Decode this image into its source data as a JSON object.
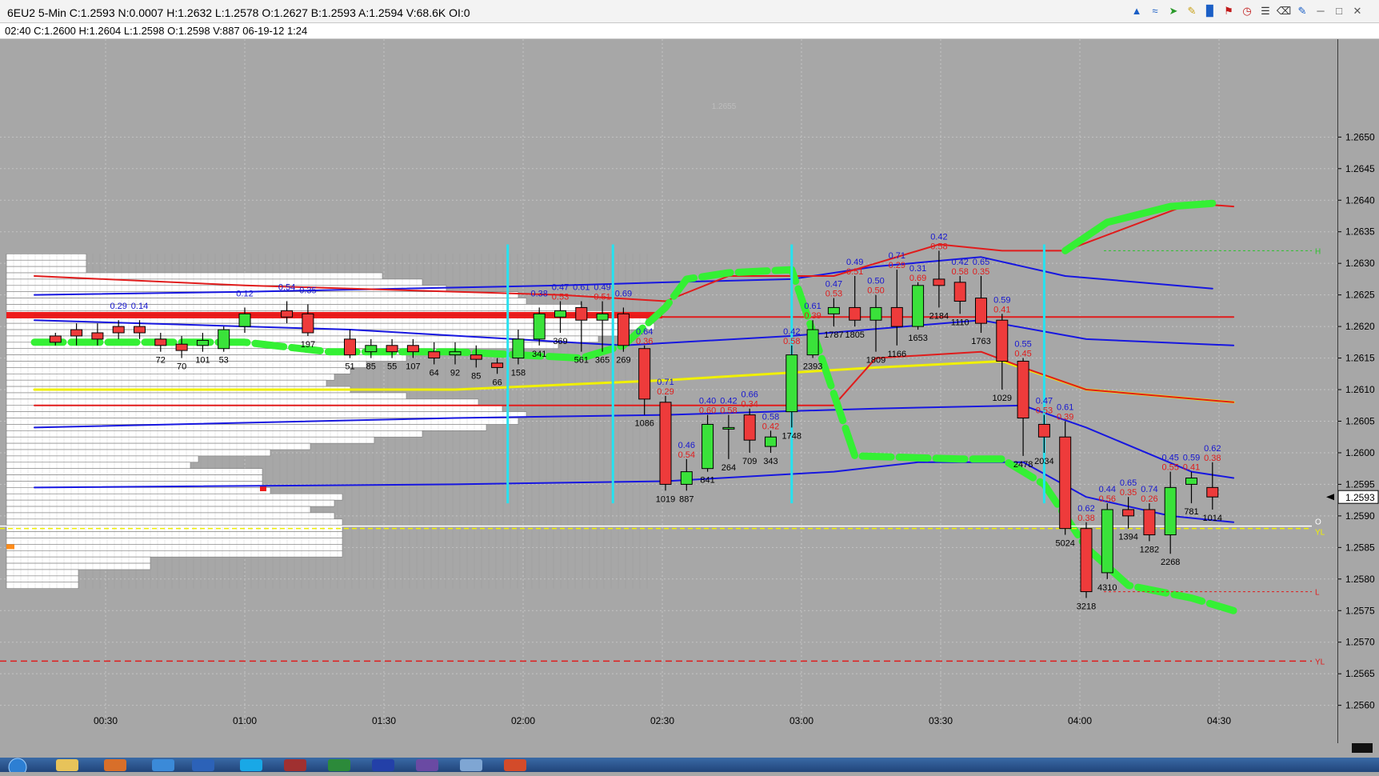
{
  "window": {
    "title": "6EU2  5-Min   C:1.2593   N:0.0007   H:1.2632   L:1.2578   O:1.2627   B:1.2593   A:1.2594   V:68.6K   OI:0",
    "info": "02:40  C:1.2600  H:1.2604  L:1.2598  O:1.2598  V:887  06-19-12  1:24",
    "toolbar_icons": [
      "cursor-icon",
      "draw-icon",
      "arrow-tool-icon",
      "pencil-icon",
      "bar-chart-icon",
      "flag-icon",
      "clock-icon",
      "list-icon",
      "trash-icon",
      "ruler-icon",
      "minimize-icon",
      "restore-icon",
      "close-icon"
    ]
  },
  "chart": {
    "watermark_price": "1.2655",
    "last_price_label": "1.2593",
    "yl_label": "YL",
    "h_label": "H",
    "l_label": "L",
    "o_label": "O",
    "colors": {
      "up": "#3ae23a",
      "down": "#ee3b3b",
      "blue": "#1717e0",
      "red": "#e01c1c",
      "yellow": "#f0f000",
      "green": "#34f034",
      "cyan": "#25e2f0",
      "bg": "#a7a7a7"
    }
  },
  "chart_data": {
    "type": "candlestick",
    "title": "6EU2 5-Min",
    "y_ticks": [
      "1.2650",
      "1.2645",
      "1.2640",
      "1.2635",
      "1.2630",
      "1.2625",
      "1.2620",
      "1.2615",
      "1.2610",
      "1.2605",
      "1.2600",
      "1.2595",
      "1.2590",
      "1.2585",
      "1.2580",
      "1.2575",
      "1.2570",
      "1.2565",
      "1.2560"
    ],
    "x_ticks": [
      "00:30",
      "01:00",
      "01:30",
      "02:00",
      "02:30",
      "03:00",
      "03:30",
      "04:00",
      "04:30"
    ],
    "candles": [
      {
        "x": 1,
        "o": 1.26185,
        "c": 1.26175,
        "h": 1.2619,
        "l": 1.2617,
        "a": "",
        "r": "",
        "b": ""
      },
      {
        "x": 2,
        "o": 1.26195,
        "c": 1.26185,
        "h": 1.26205,
        "l": 1.2617,
        "a": "",
        "r": "",
        "b": ""
      },
      {
        "x": 3,
        "o": 1.2619,
        "c": 1.2618,
        "h": 1.26205,
        "l": 1.2617,
        "a": "",
        "r": "",
        "b": ""
      },
      {
        "x": 4,
        "o": 1.262,
        "c": 1.2619,
        "h": 1.2621,
        "l": 1.2618,
        "a": "0.29",
        "r": "",
        "b": ""
      },
      {
        "x": 5,
        "o": 1.262,
        "c": 1.2619,
        "h": 1.2621,
        "l": 1.2618,
        "a": "0.14",
        "r": "",
        "b": ""
      },
      {
        "x": 6,
        "o": 1.2618,
        "c": 1.2617,
        "h": 1.2619,
        "l": 1.2616,
        "a": "",
        "r": "",
        "b": "72"
      },
      {
        "x": 7,
        "o": 1.26172,
        "c": 1.26162,
        "h": 1.26185,
        "l": 1.2615,
        "a": "",
        "r": "",
        "b": "70"
      },
      {
        "x": 8,
        "o": 1.2617,
        "c": 1.26178,
        "h": 1.2619,
        "l": 1.2616,
        "a": "",
        "r": "",
        "b": "101"
      },
      {
        "x": 9,
        "o": 1.26165,
        "c": 1.26195,
        "h": 1.262,
        "l": 1.2616,
        "a": "",
        "r": "",
        "b": "53"
      },
      {
        "x": 10,
        "o": 1.262,
        "c": 1.2622,
        "h": 1.2623,
        "l": 1.2619,
        "a": "0.12",
        "r": "",
        "b": ""
      },
      {
        "x": 12,
        "o": 1.26225,
        "c": 1.26215,
        "h": 1.2624,
        "l": 1.26205,
        "a": "0.54",
        "r": "",
        "b": ""
      },
      {
        "x": 13,
        "o": 1.2622,
        "c": 1.2619,
        "h": 1.26235,
        "l": 1.26185,
        "a": "0.35",
        "r": "",
        "b": "197"
      },
      {
        "x": 15,
        "o": 1.2618,
        "c": 1.26155,
        "h": 1.26195,
        "l": 1.2615,
        "a": "",
        "r": "",
        "b": "51"
      },
      {
        "x": 16,
        "o": 1.2616,
        "c": 1.2617,
        "h": 1.2618,
        "l": 1.2615,
        "a": "",
        "r": "",
        "b": "85"
      },
      {
        "x": 17,
        "o": 1.2617,
        "c": 1.2616,
        "h": 1.2618,
        "l": 1.2615,
        "a": "",
        "r": "",
        "b": "55"
      },
      {
        "x": 18,
        "o": 1.2617,
        "c": 1.2616,
        "h": 1.2618,
        "l": 1.2615,
        "a": "",
        "r": "",
        "b": "107"
      },
      {
        "x": 19,
        "o": 1.2616,
        "c": 1.2615,
        "h": 1.26175,
        "l": 1.2614,
        "a": "",
        "r": "",
        "b": "64"
      },
      {
        "x": 20,
        "o": 1.26155,
        "c": 1.2616,
        "h": 1.26175,
        "l": 1.2614,
        "a": "",
        "r": "",
        "b": "92"
      },
      {
        "x": 21,
        "o": 1.26155,
        "c": 1.26148,
        "h": 1.2617,
        "l": 1.26135,
        "a": "",
        "r": "",
        "b": "85"
      },
      {
        "x": 22,
        "o": 1.26142,
        "c": 1.26135,
        "h": 1.2615,
        "l": 1.26125,
        "a": "",
        "r": "",
        "b": "66"
      },
      {
        "x": 23,
        "o": 1.2615,
        "c": 1.2618,
        "h": 1.26195,
        "l": 1.2614,
        "a": "",
        "r": "",
        "b": "158"
      },
      {
        "x": 24,
        "o": 1.2618,
        "c": 1.2622,
        "h": 1.2623,
        "l": 1.2617,
        "a": "0.38",
        "r": "",
        "b": "341"
      },
      {
        "x": 25,
        "o": 1.26215,
        "c": 1.26225,
        "h": 1.2624,
        "l": 1.2619,
        "a": "0.47",
        "r": "0.53",
        "b": "369"
      },
      {
        "x": 26,
        "o": 1.2623,
        "c": 1.2621,
        "h": 1.2624,
        "l": 1.2616,
        "a": "0.61",
        "r": "",
        "b": "561"
      },
      {
        "x": 27,
        "o": 1.2621,
        "c": 1.2622,
        "h": 1.2624,
        "l": 1.2616,
        "a": "0.49",
        "r": "0.51",
        "b": "365"
      },
      {
        "x": 28,
        "o": 1.2622,
        "c": 1.2617,
        "h": 1.2623,
        "l": 1.2616,
        "a": "0.69",
        "r": "",
        "b": "269"
      },
      {
        "x": 29,
        "o": 1.26165,
        "c": 1.26085,
        "h": 1.2617,
        "l": 1.2606,
        "a": "0.64",
        "r": "0.36",
        "b": "1086"
      },
      {
        "x": 30,
        "o": 1.2608,
        "c": 1.2595,
        "h": 1.2609,
        "l": 1.2594,
        "a": "0.71",
        "r": "0.29",
        "b": "1019"
      },
      {
        "x": 31,
        "o": 1.2595,
        "c": 1.2597,
        "h": 1.2599,
        "l": 1.2594,
        "a": "0.46",
        "r": "0.54",
        "b": "887"
      },
      {
        "x": 32,
        "o": 1.25975,
        "c": 1.26045,
        "h": 1.2606,
        "l": 1.2597,
        "a": "0.40",
        "r": "0.60",
        "b": "841"
      },
      {
        "x": 33,
        "o": 1.2604,
        "c": 1.2604,
        "h": 1.2606,
        "l": 1.2599,
        "a": "0.42",
        "r": "0.58",
        "b": "264"
      },
      {
        "x": 34,
        "o": 1.2606,
        "c": 1.2602,
        "h": 1.2607,
        "l": 1.26,
        "a": "0.66",
        "r": "0.34",
        "b": "709"
      },
      {
        "x": 35,
        "o": 1.2601,
        "c": 1.26025,
        "h": 1.26035,
        "l": 1.26,
        "a": "0.58",
        "r": "0.42",
        "b": "343"
      },
      {
        "x": 36,
        "o": 1.26065,
        "c": 1.26155,
        "h": 1.2617,
        "l": 1.2604,
        "a": "0.42",
        "r": "0.58",
        "b": "1748"
      },
      {
        "x": 37,
        "o": 1.26155,
        "c": 1.26195,
        "h": 1.2621,
        "l": 1.2615,
        "a": "0.61",
        "r": "0.39",
        "b": "2393"
      },
      {
        "x": 38,
        "o": 1.2622,
        "c": 1.2623,
        "h": 1.26245,
        "l": 1.262,
        "a": "0.47",
        "r": "0.53",
        "b": "1787"
      },
      {
        "x": 39,
        "o": 1.2623,
        "c": 1.2621,
        "h": 1.2628,
        "l": 1.262,
        "a": "0.49",
        "r": "0.51",
        "b": "1805"
      },
      {
        "x": 40,
        "o": 1.2621,
        "c": 1.2623,
        "h": 1.2625,
        "l": 1.2616,
        "a": "0.50",
        "r": "0.50",
        "b": "1809"
      },
      {
        "x": 41,
        "o": 1.2623,
        "c": 1.262,
        "h": 1.2629,
        "l": 1.2617,
        "a": "0.71",
        "r": "0.29",
        "b": "1166"
      },
      {
        "x": 42,
        "o": 1.262,
        "c": 1.26265,
        "h": 1.2627,
        "l": 1.26195,
        "a": "0.31",
        "r": "0.69",
        "b": "1653"
      },
      {
        "x": 43,
        "o": 1.26275,
        "c": 1.26265,
        "h": 1.2632,
        "l": 1.2623,
        "a": "0.42",
        "r": "0.58",
        "b": "2184"
      },
      {
        "x": 44,
        "o": 1.2627,
        "c": 1.2624,
        "h": 1.2628,
        "l": 1.2622,
        "a": "0.42",
        "r": "0.58",
        "b": "1110"
      },
      {
        "x": 45,
        "o": 1.26245,
        "c": 1.26205,
        "h": 1.2628,
        "l": 1.2619,
        "a": "0.65",
        "r": "0.35",
        "b": "1763"
      },
      {
        "x": 46,
        "o": 1.2621,
        "c": 1.26145,
        "h": 1.2622,
        "l": 1.261,
        "a": "0.59",
        "r": "0.41",
        "b": "1029"
      },
      {
        "x": 47,
        "o": 1.26145,
        "c": 1.26055,
        "h": 1.2615,
        "l": 1.25995,
        "a": "0.55",
        "r": "0.45",
        "b": "2478"
      },
      {
        "x": 48,
        "o": 1.26045,
        "c": 1.26025,
        "h": 1.2606,
        "l": 1.26,
        "a": "0.47",
        "r": "0.53",
        "b": "2034"
      },
      {
        "x": 49,
        "o": 1.26025,
        "c": 1.2588,
        "h": 1.2605,
        "l": 1.2587,
        "a": "0.61",
        "r": "0.39",
        "b": "5024"
      },
      {
        "x": 50,
        "o": 1.2588,
        "c": 1.2578,
        "h": 1.2589,
        "l": 1.2577,
        "a": "0.62",
        "r": "0.38",
        "b": "3218"
      },
      {
        "x": 51,
        "o": 1.2581,
        "c": 1.2591,
        "h": 1.2592,
        "l": 1.258,
        "a": "0.44",
        "r": "0.56",
        "b": "4310"
      },
      {
        "x": 52,
        "o": 1.2591,
        "c": 1.259,
        "h": 1.2593,
        "l": 1.2588,
        "a": "0.65",
        "r": "0.35",
        "b": "1394"
      },
      {
        "x": 53,
        "o": 1.2591,
        "c": 1.2587,
        "h": 1.2592,
        "l": 1.2586,
        "a": "0.74",
        "r": "0.26",
        "b": "1282"
      },
      {
        "x": 54,
        "o": 1.2587,
        "c": 1.25945,
        "h": 1.2597,
        "l": 1.2584,
        "a": "0.45",
        "r": "0.55",
        "b": "2268"
      },
      {
        "x": 55,
        "o": 1.2595,
        "c": 1.2596,
        "h": 1.2597,
        "l": 1.2592,
        "a": "0.59",
        "r": "0.41",
        "b": "781"
      },
      {
        "x": 56,
        "o": 1.25945,
        "c": 1.2593,
        "h": 1.25985,
        "l": 1.2591,
        "a": "0.62",
        "r": "0.38",
        "b": "1014"
      }
    ],
    "lines": {
      "blue_upper": [
        [
          0,
          1.2625
        ],
        [
          10,
          1.26255
        ],
        [
          25,
          1.26265
        ],
        [
          30,
          1.2627
        ],
        [
          36,
          1.26275
        ],
        [
          40,
          1.26295
        ],
        [
          45,
          1.2631
        ],
        [
          49,
          1.2628
        ],
        [
          56,
          1.2626
        ]
      ],
      "red_upper": [
        [
          0,
          1.2628
        ],
        [
          10,
          1.26265
        ],
        [
          25,
          1.2625
        ],
        [
          30,
          1.2624
        ],
        [
          33,
          1.2628
        ],
        [
          38,
          1.2628
        ],
        [
          43,
          1.2633
        ],
        [
          46,
          1.2632
        ],
        [
          49,
          1.2632
        ],
        [
          55,
          1.26395
        ],
        [
          57,
          1.2639
        ]
      ],
      "red_mid": [
        [
          0,
          1.26218
        ],
        [
          27,
          1.26218
        ],
        [
          30,
          1.26215
        ],
        [
          45,
          1.26215
        ],
        [
          57,
          1.26215
        ]
      ],
      "blue_mid": [
        [
          0,
          1.2621
        ],
        [
          15,
          1.26195
        ],
        [
          28,
          1.2617
        ],
        [
          36,
          1.26185
        ],
        [
          45,
          1.2621
        ],
        [
          50,
          1.2618
        ],
        [
          57,
          1.2617
        ]
      ],
      "yellow": [
        [
          0,
          1.261
        ],
        [
          20,
          1.261
        ],
        [
          30,
          1.26115
        ],
        [
          40,
          1.26135
        ],
        [
          46,
          1.26145
        ],
        [
          50,
          1.261
        ],
        [
          57,
          1.2608
        ]
      ],
      "red_low": [
        [
          0,
          1.26075
        ],
        [
          38,
          1.26075
        ],
        [
          40,
          1.2615
        ],
        [
          45,
          1.2616
        ],
        [
          47,
          1.26135
        ],
        [
          50,
          1.261
        ],
        [
          57,
          1.2608
        ]
      ],
      "blue_low": [
        [
          0,
          1.2604
        ],
        [
          20,
          1.26055
        ],
        [
          30,
          1.2606
        ],
        [
          40,
          1.2607
        ],
        [
          47,
          1.26075
        ],
        [
          50,
          1.2604
        ],
        [
          55,
          1.2597
        ],
        [
          57,
          1.2596
        ]
      ],
      "blue_bottom": [
        [
          0,
          1.25945
        ],
        [
          20,
          1.2595
        ],
        [
          30,
          1.25955
        ],
        [
          38,
          1.2597
        ],
        [
          42,
          1.25985
        ],
        [
          47,
          1.25985
        ],
        [
          50,
          1.2593
        ],
        [
          54,
          1.259
        ],
        [
          57,
          1.2589
        ]
      ],
      "green_trail": [
        [
          0,
          1.26175
        ],
        [
          10,
          1.26175
        ],
        [
          14,
          1.2616
        ],
        [
          20,
          1.2616
        ],
        [
          26,
          1.2615
        ],
        [
          28,
          1.2617
        ],
        [
          30,
          1.2623
        ],
        [
          31,
          1.26275
        ],
        [
          33,
          1.26285
        ],
        [
          36,
          1.2629
        ],
        [
          39,
          1.25995
        ],
        [
          44,
          1.2599
        ],
        [
          46,
          1.2599
        ],
        [
          48,
          1.2595
        ],
        [
          50,
          1.2585
        ],
        [
          52,
          1.2579
        ],
        [
          55,
          1.2577
        ],
        [
          57,
          1.2575
        ]
      ],
      "green_trail2": [
        [
          49,
          1.2632
        ],
        [
          51,
          1.26365
        ],
        [
          54,
          1.2639
        ],
        [
          56,
          1.26395
        ]
      ]
    },
    "levels": {
      "yl_upper": 1.2588,
      "yl_lower": 1.2567,
      "h_level": 1.2632,
      "l_level": 1.2578
    },
    "cyan_verticals": [
      22.5,
      27.5,
      36.0,
      48.0
    ],
    "ylim": [
      1.2554,
      1.26655
    ]
  }
}
